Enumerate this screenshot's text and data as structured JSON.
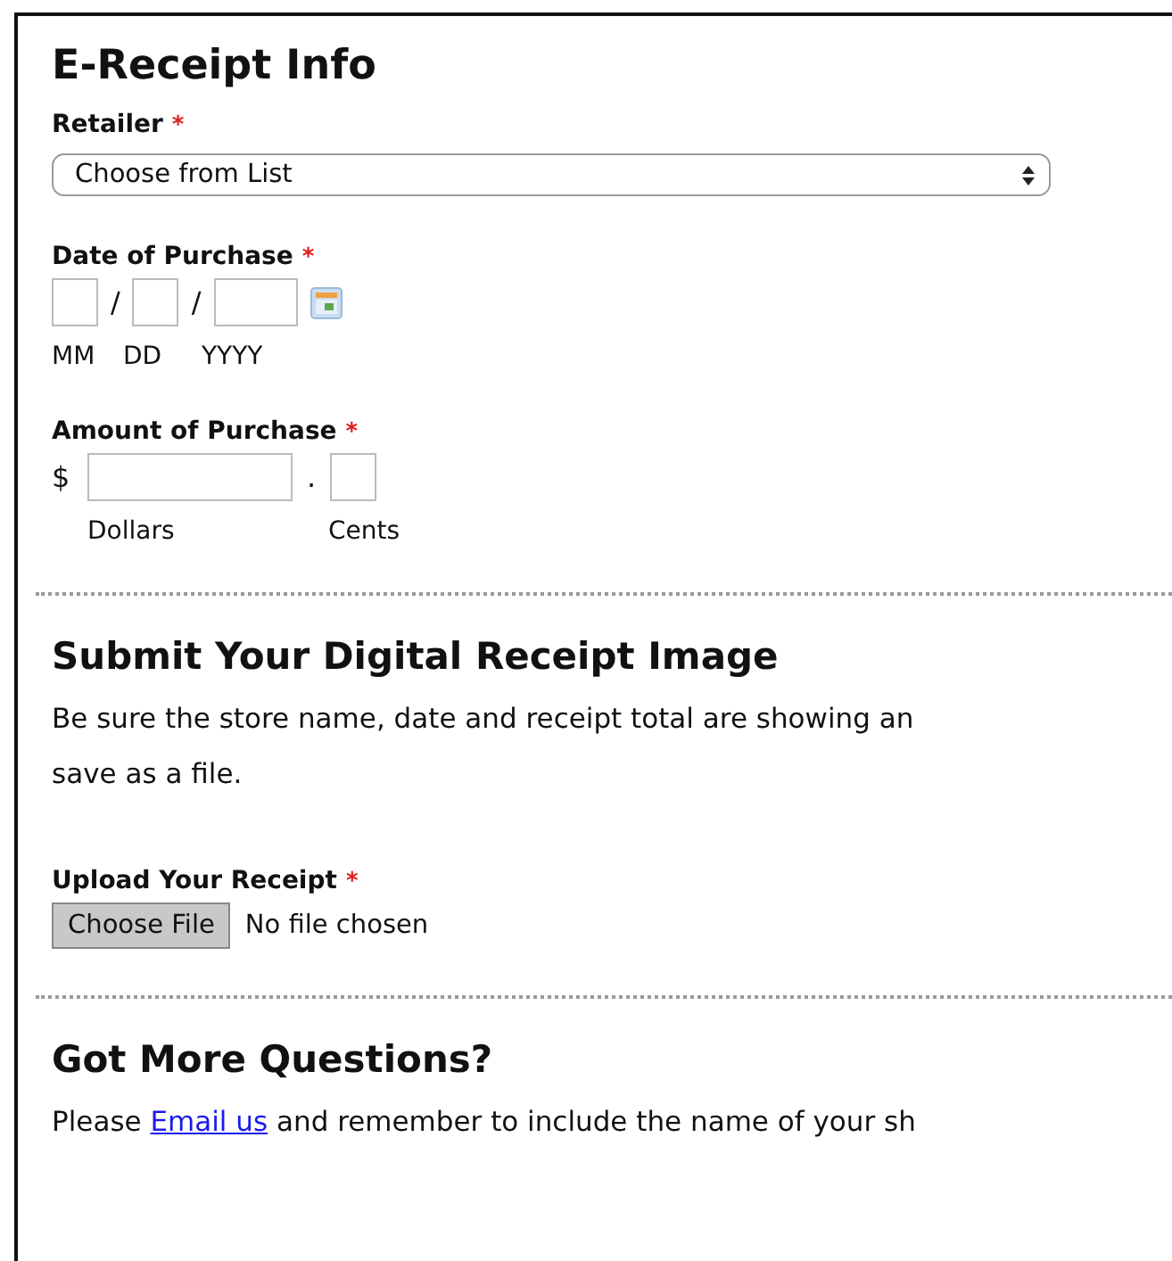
{
  "sections": [
    {
      "title": "E-Receipt Info",
      "fields": [
        {
          "kind": "select",
          "label": "Retailer",
          "required_mark": "*",
          "value": "Choose from List"
        },
        {
          "kind": "date",
          "label": "Date of Purchase",
          "required_mark": "*",
          "separators": [
            "/",
            "/"
          ],
          "captions": [
            "MM",
            "DD",
            "YYYY"
          ]
        },
        {
          "kind": "amount",
          "label": "Amount of Purchase",
          "required_mark": "*",
          "currency": "$",
          "decimal": ".",
          "captions": [
            "Dollars",
            "Cents"
          ]
        }
      ]
    },
    {
      "title": "Submit Your Digital Receipt Image",
      "text_lines": [
        "Be sure the store name, date and receipt total are showing an",
        "save as a file."
      ],
      "fields": [
        {
          "kind": "file",
          "label": "Upload Your Receipt",
          "required_mark": "*",
          "button": "Choose File",
          "status": "No file chosen"
        }
      ]
    },
    {
      "title": "Got More Questions?",
      "link_text": {
        "before": "Please ",
        "link": "Email us",
        "after": " and remember to include the name of your sh"
      }
    }
  ]
}
